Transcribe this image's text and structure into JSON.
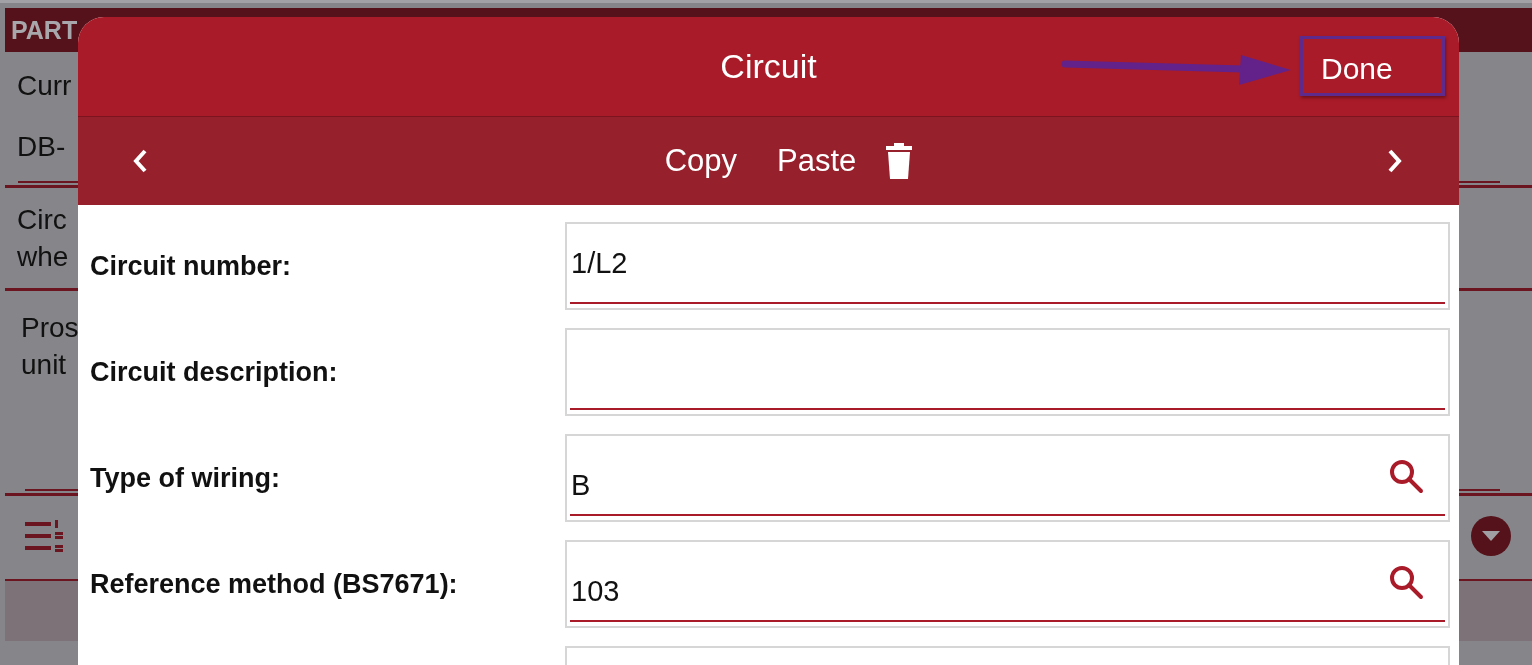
{
  "background": {
    "header": "PART",
    "rows": [
      {
        "kind": "text",
        "lines": [
          "Curr"
        ]
      },
      {
        "kind": "field",
        "lines": [
          "DB-"
        ]
      },
      {
        "kind": "text",
        "lines": [
          "Circ",
          "whe"
        ]
      },
      {
        "kind": "text",
        "lines": [
          "Pros",
          "unit"
        ]
      }
    ]
  },
  "dialog": {
    "title": "Circuit",
    "done": {
      "label": "Done",
      "highlighted": true
    },
    "toolbar": [
      "Copy",
      "Paste"
    ],
    "fields": [
      {
        "kind": "text",
        "label": "Circuit number:",
        "value": "1/L2"
      },
      {
        "kind": "text",
        "label": "Circuit description:"
      },
      {
        "kind": "lookup",
        "label": "Type of wiring:",
        "value": "B"
      },
      {
        "kind": "lookup",
        "label": "Reference method (BS7671):",
        "value": "103"
      },
      {
        "kind": "text"
      }
    ]
  }
}
